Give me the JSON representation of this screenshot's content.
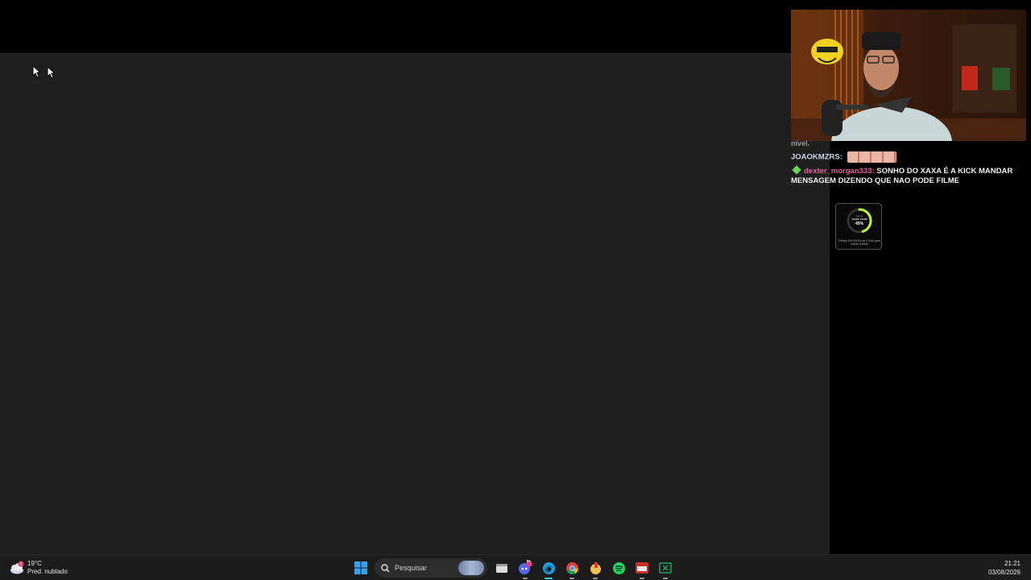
{
  "chat": {
    "cutoff_text": "nível.",
    "messages": [
      {
        "user": "JOAOKMZRS:",
        "text": ""
      },
      {
        "user": "dexter_morgan333:",
        "text": "SONHO DO XAXA É A KICK MANDAR MENSAGEM DIZENDO QUE NAO PODE FILME"
      }
    ]
  },
  "goal_widget": {
    "title_top": "meta de",
    "title": "LEVEL ZAAM",
    "percent": "45%",
    "progress": 0.45,
    "caption": "Faltam 000 KICKs de 0 Kick para Iniciar a Meta"
  },
  "taskbar": {
    "weather": {
      "temperature": "19°C",
      "condition": "Pred. nublado",
      "icon": "cloud-icon"
    },
    "search_placeholder": "Pesquisar",
    "apps": [
      "windows-start-icon",
      "search-icon",
      "file-explorer-icon",
      "discord-icon",
      "edge-icon",
      "chrome-icon",
      "game-app-icon",
      "spotify-icon",
      "recorder-icon",
      "excel-icon"
    ],
    "discord_badge": "9+",
    "time": "21:21",
    "date": "03/08/2026"
  },
  "colors": {
    "main_bg": "#1f1f1f",
    "accent_green": "#c4f22c",
    "chat_user_pink": "#e0609a"
  }
}
